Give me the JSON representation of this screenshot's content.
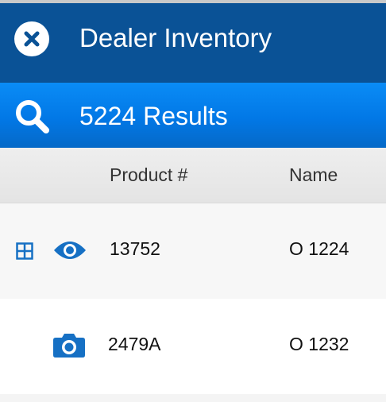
{
  "header": {
    "title": "Dealer Inventory",
    "close_icon": "close-circle-icon"
  },
  "results": {
    "label": "5224 Results",
    "search_icon": "search-icon"
  },
  "table": {
    "columns": [
      "Product #",
      "Name"
    ],
    "rows": [
      {
        "product": "13752",
        "name": "O 1224",
        "icons": [
          "grid-icon",
          "eye-icon"
        ]
      },
      {
        "product": "2479A",
        "name": "O 1232",
        "icons": [
          "camera-icon"
        ]
      }
    ]
  },
  "colors": {
    "title_bar": "#0a5296",
    "results_bar": "#0278e6",
    "icon_blue": "#1670c4",
    "header_bg": "#e9e9e9"
  }
}
